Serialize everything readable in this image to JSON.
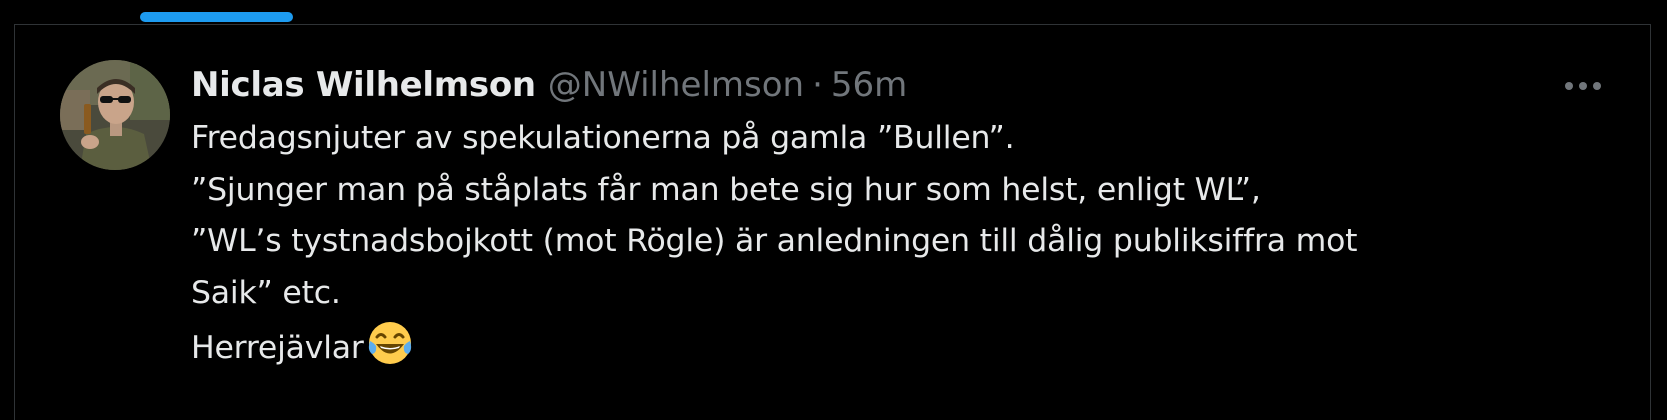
{
  "tweet": {
    "author": {
      "display_name": "Niclas Wilhelmson",
      "handle": "@NWilhelmson",
      "separator": "·",
      "time": "56m",
      "avatar_icon": "profile-photo"
    },
    "more_icon": "more-horizontal-icon",
    "lines": [
      "Fredagsnjuter av spekulationerna på gamla ”Bullen”.",
      "”Sjunger man på ståplats får man bete sig hur som helst, enligt WL”,",
      "”WL’s tystnadsbojkott (mot Rögle) är anledningen till dålig publiksiffra mot",
      "Saik” etc.",
      "Herrejävlar"
    ],
    "trailing_emoji": "face-with-tears-of-joy"
  },
  "colors": {
    "background": "#000000",
    "text_primary": "#e7e9ea",
    "text_secondary": "#71767b",
    "accent": "#1d9bf0",
    "border": "#2f3336"
  }
}
